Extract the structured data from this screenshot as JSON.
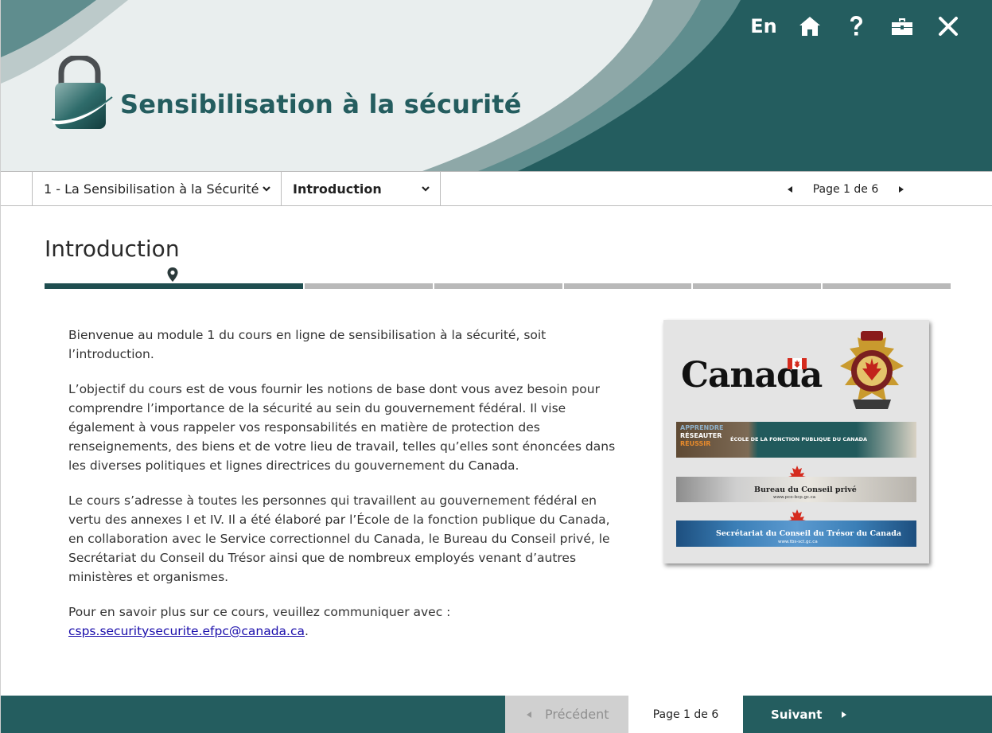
{
  "header": {
    "app_title": "Sensibilisation à la sécurité",
    "language_toggle": "En",
    "icons": [
      "home-icon",
      "help-icon",
      "toolbox-icon",
      "close-icon"
    ],
    "colors": {
      "primary": "#245d5f",
      "header_light": "#e8eded"
    }
  },
  "nav": {
    "module_select": "1 - La Sensibilisation à la Sécurité",
    "section_select": "Introduction",
    "page_indicator": "Page 1 de 6"
  },
  "content": {
    "title": "Introduction",
    "progress": {
      "current_step": 1,
      "total_steps": 6
    },
    "paragraphs": [
      "Bienvenue au module 1 du cours en ligne de sensibilisation à la sécurité, soit l’introduction.",
      "L’objectif du cours est de vous fournir les notions de base dont vous avez besoin pour comprendre l’importance de la sécurité au sein du gouvernement fédéral. Il vise également à vous rappeler vos responsabilités en matière de protection des renseignements, des biens et de votre lieu de travail, telles qu’elles sont énoncées dans les diverses politiques et lignes directrices du gouvernement du Canada.",
      "Le cours s’adresse à toutes les personnes qui travaillent au gouvernement fédéral en vertu des annexes I et IV. Il a été élaboré par l’École de la fonction publique du Canada, en collaboration avec le Service correctionnel du Canada, le Bureau du Conseil privé, le Secrétariat du Conseil du Trésor ainsi que de nombreux employés venant d’autres ministères et organismes."
    ],
    "contact_text": "Pour en savoir plus sur ce cours, veuillez communiquer avec :",
    "contact_email": "csps.securitysecurite.efpc@canada.ca",
    "contact_end": "."
  },
  "image_panel": {
    "wordmark": "Canada",
    "banner1_words": [
      "APPRENDRE",
      "RÉSEAUTER",
      "RÉUSSIR"
    ],
    "banner1_text": "ÉCOLE DE LA FONCTION PUBLIQUE DU CANADA",
    "banner2_text": "Bureau du Conseil privé",
    "banner2_url": "www.pco-bcp.gc.ca",
    "banner3_text": "Secrétariat du Conseil du Trésor du Canada",
    "banner3_url": "www.tbs-sct.gc.ca"
  },
  "footer": {
    "prev_label": "Précédent",
    "page_indicator": "Page 1 de 6",
    "next_label": "Suivant"
  }
}
